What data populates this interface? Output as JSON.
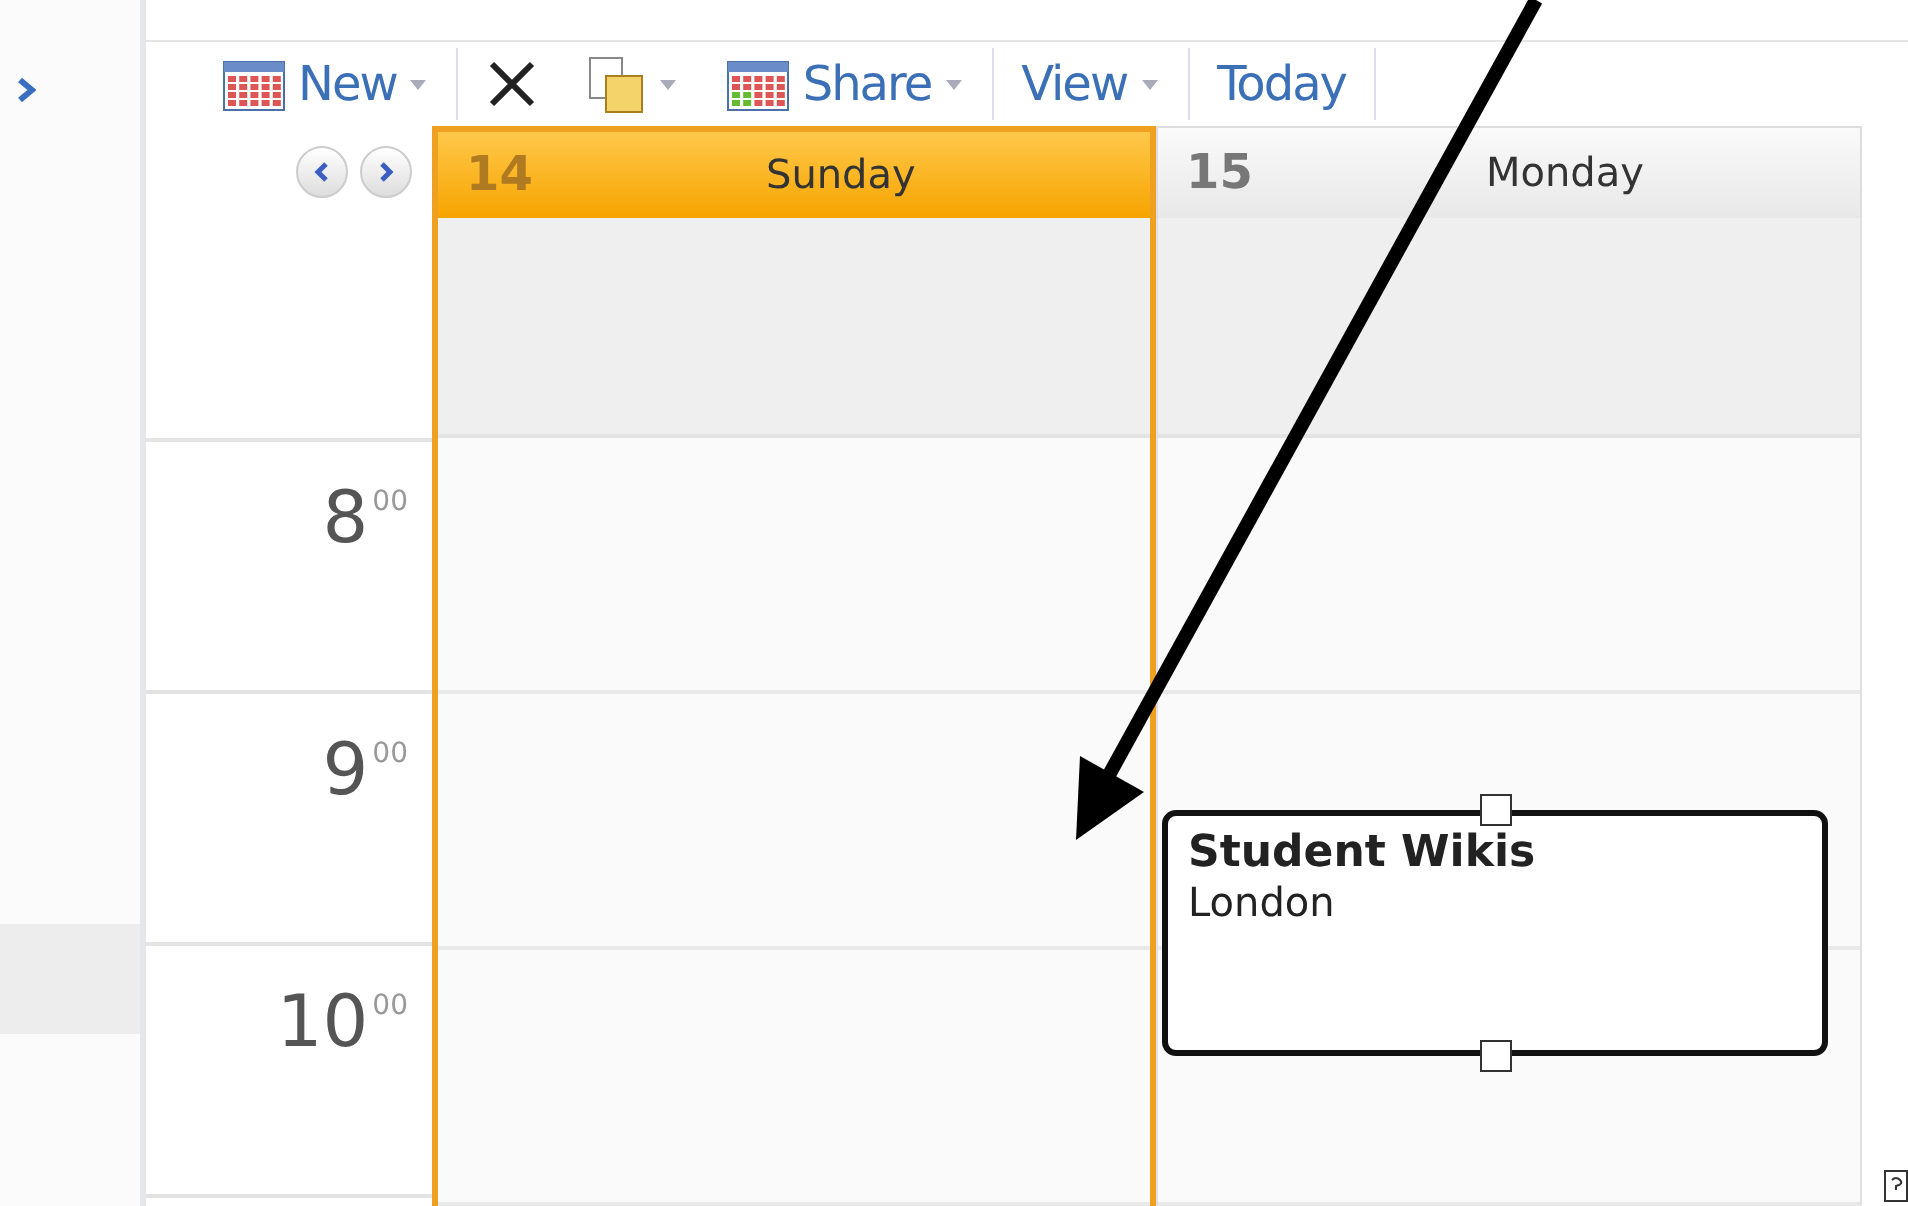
{
  "toolbar": [
    {
      "kind": "new",
      "label": "New",
      "menu": true
    },
    {
      "kind": "delete",
      "menu": false
    },
    {
      "kind": "move",
      "menu": true
    },
    {
      "kind": "share",
      "label": "Share",
      "menu": true
    },
    {
      "kind": "view",
      "label": "View",
      "menu": true
    },
    {
      "kind": "today",
      "label": "Today",
      "menu": false
    }
  ],
  "days": [
    {
      "number": "14",
      "name": "Sunday",
      "selected": true
    },
    {
      "number": "15",
      "name": "Monday",
      "selected": false,
      "events": [
        {
          "title": "Student Wikis",
          "location": "London",
          "selected": true
        }
      ]
    }
  ],
  "hours": [
    {
      "hour": "8",
      "minutes": "00"
    },
    {
      "hour": "9",
      "minutes": "00"
    },
    {
      "hour": "10",
      "minutes": "00"
    }
  ]
}
